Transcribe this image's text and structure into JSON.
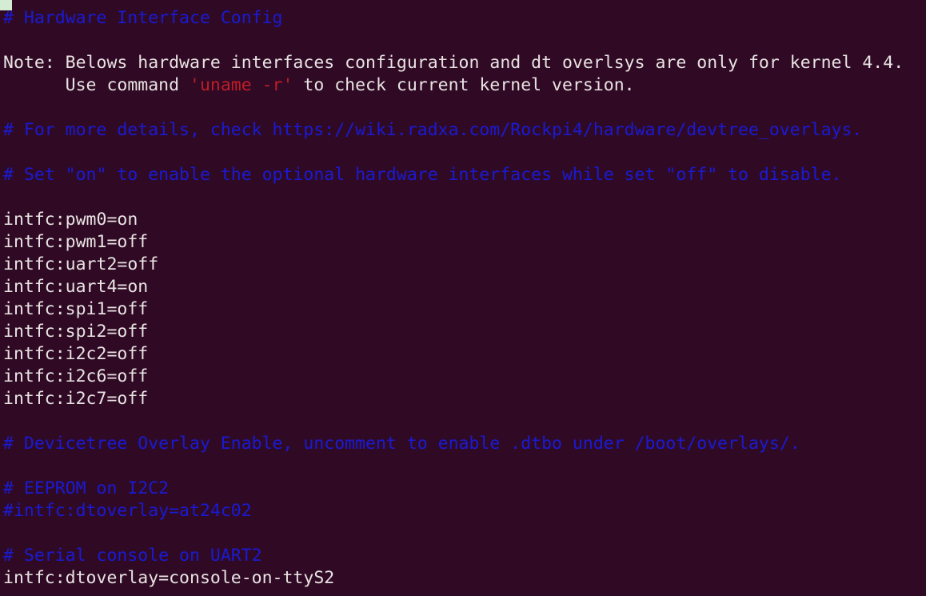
{
  "terminal": {
    "background_color": "#300a24",
    "foreground_color": "#e8e3e3",
    "comment_color": "#1a1ad4",
    "string_color": "#c01c28",
    "cursor_color": "#d3ecd3",
    "cursor_name": "block-cursor"
  },
  "lines": [
    {
      "id": "l1",
      "kind": "comment",
      "text": "# Hardware Interface Config"
    },
    {
      "id": "l2",
      "kind": "blank",
      "text": ""
    },
    {
      "id": "l3",
      "kind": "text",
      "text": "Note: Belows hardware interfaces configuration and dt overlsys are only for kernel 4.4."
    },
    {
      "id": "l4",
      "kind": "mixed",
      "text": "      Use command 'uname -r' to check current kernel version.",
      "segments": [
        {
          "kind": "text",
          "text": "      Use command "
        },
        {
          "kind": "string",
          "text": "'uname -r'"
        },
        {
          "kind": "text",
          "text": " to check current kernel version."
        }
      ]
    },
    {
      "id": "l5",
      "kind": "blank",
      "text": ""
    },
    {
      "id": "l6",
      "kind": "comment",
      "text": "# For more details, check https://wiki.radxa.com/Rockpi4/hardware/devtree_overlays."
    },
    {
      "id": "l7",
      "kind": "blank",
      "text": ""
    },
    {
      "id": "l8",
      "kind": "comment",
      "text": "# Set \"on\" to enable the optional hardware interfaces while set \"off\" to disable."
    },
    {
      "id": "l9",
      "kind": "blank",
      "text": ""
    },
    {
      "id": "l10",
      "kind": "text",
      "text": "intfc:pwm0=on"
    },
    {
      "id": "l11",
      "kind": "text",
      "text": "intfc:pwm1=off"
    },
    {
      "id": "l12",
      "kind": "text",
      "text": "intfc:uart2=off"
    },
    {
      "id": "l13",
      "kind": "text",
      "text": "intfc:uart4=on"
    },
    {
      "id": "l14",
      "kind": "text",
      "text": "intfc:spi1=off"
    },
    {
      "id": "l15",
      "kind": "text",
      "text": "intfc:spi2=off"
    },
    {
      "id": "l16",
      "kind": "text",
      "text": "intfc:i2c2=off"
    },
    {
      "id": "l17",
      "kind": "text",
      "text": "intfc:i2c6=off"
    },
    {
      "id": "l18",
      "kind": "text",
      "text": "intfc:i2c7=off"
    },
    {
      "id": "l19",
      "kind": "blank",
      "text": ""
    },
    {
      "id": "l20",
      "kind": "comment",
      "text": "# Devicetree Overlay Enable, uncomment to enable .dtbo under /boot/overlays/."
    },
    {
      "id": "l21",
      "kind": "blank",
      "text": ""
    },
    {
      "id": "l22",
      "kind": "comment",
      "text": "# EEPROM on I2C2"
    },
    {
      "id": "l23",
      "kind": "comment",
      "text": "#intfc:dtoverlay=at24c02"
    },
    {
      "id": "l24",
      "kind": "blank",
      "text": ""
    },
    {
      "id": "l25",
      "kind": "comment",
      "text": "# Serial console on UART2"
    },
    {
      "id": "l26",
      "kind": "text",
      "text": "intfc:dtoverlay=console-on-ttyS2"
    }
  ],
  "settings": {
    "pwm0": "on",
    "pwm1": "off",
    "uart2": "off",
    "uart4": "on",
    "spi1": "off",
    "spi2": "off",
    "i2c2": "off",
    "i2c6": "off",
    "i2c7": "off",
    "dtoverlay_at24c02": "commented-out",
    "dtoverlay_console_on_ttyS2": "enabled"
  }
}
